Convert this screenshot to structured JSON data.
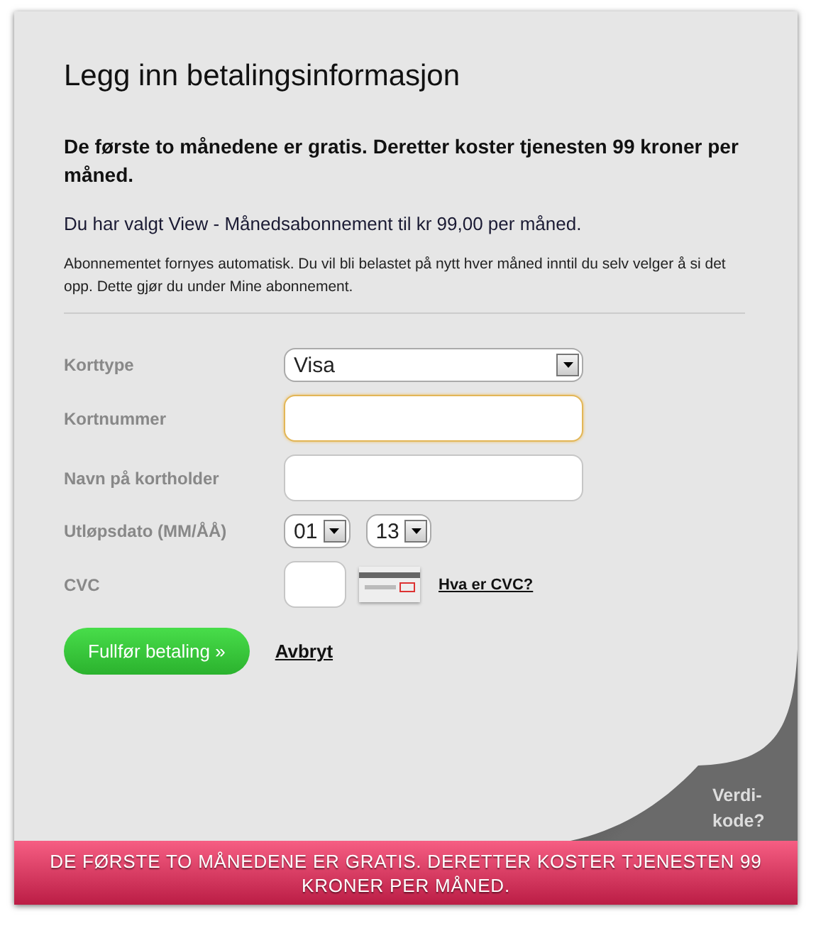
{
  "title": "Legg inn betalingsinformasjon",
  "offer": "De første to månedene er gratis. Deretter koster tjenesten 99 kroner per måned.",
  "subscription": "Du har valgt View - Månedsabonnement til kr 99,00 per måned.",
  "renewal_note": "Abonnementet fornyes automatisk. Du vil bli belastet på nytt hver måned inntil du selv velger å si det opp. Dette gjør du under Mine abonnement.",
  "form": [
    {
      "kind": "select",
      "label": "Korttype",
      "value": "Visa"
    },
    {
      "kind": "input",
      "label": "Kortnummer",
      "focused": true
    },
    {
      "kind": "input",
      "label": "Navn på kortholder",
      "focused": false
    },
    {
      "kind": "date",
      "label": "Utløpsdato (MM/ÅÅ)",
      "month": "01",
      "year": "13"
    },
    {
      "kind": "cvc",
      "label": "CVC",
      "help_link": "Hva er CVC?"
    }
  ],
  "submit_button": "Fullfør betaling »",
  "cancel_link": "Avbryt",
  "corner_link": "Verdi-kode?",
  "banner": "DE FØRSTE TO MÅNEDENE ER GRATIS. DERETTER KOSTER TJENESTEN 99 KRONER PER MÅNED."
}
